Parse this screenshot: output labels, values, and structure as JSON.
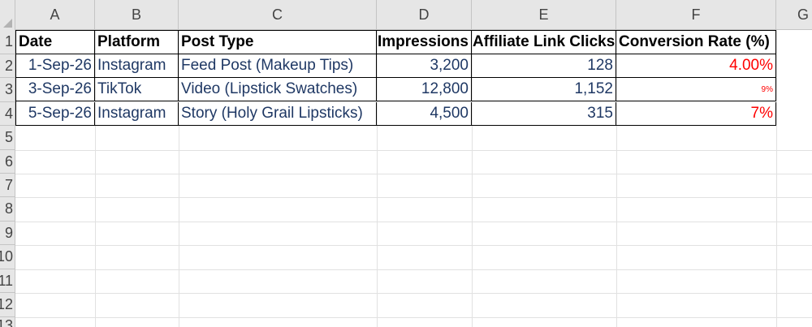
{
  "columns": [
    "A",
    "B",
    "C",
    "D",
    "E",
    "F",
    "G"
  ],
  "rows": [
    "1",
    "2",
    "3",
    "4",
    "5",
    "6",
    "7",
    "8",
    "9",
    "10",
    "11",
    "12",
    "13"
  ],
  "headers": {
    "date": "Date",
    "platform": "Platform",
    "post_type": "Post Type",
    "impressions": "Impressions",
    "clicks": "Affiliate Link Clicks",
    "conversion": "Conversion Rate (%)"
  },
  "data_rows": [
    {
      "date": "1-Sep-26",
      "platform": "Instagram",
      "post_type": "Feed Post (Makeup Tips)",
      "impressions": "3,200",
      "clicks": "128",
      "conversion": "4.00%"
    },
    {
      "date": "3-Sep-26",
      "platform": "TikTok",
      "post_type": "Video (Lipstick Swatches)",
      "impressions": "12,800",
      "clicks": "1,152",
      "conversion": "9%"
    },
    {
      "date": "5-Sep-26",
      "platform": "Instagram",
      "post_type": "Story (Holy Grail Lipsticks)",
      "impressions": "4,500",
      "clicks": "315",
      "conversion": "7%"
    }
  ],
  "colors": {
    "text_navy": "#1f3864",
    "conversion_red": "#ff0000",
    "header_bg": "#e6e6e6"
  }
}
